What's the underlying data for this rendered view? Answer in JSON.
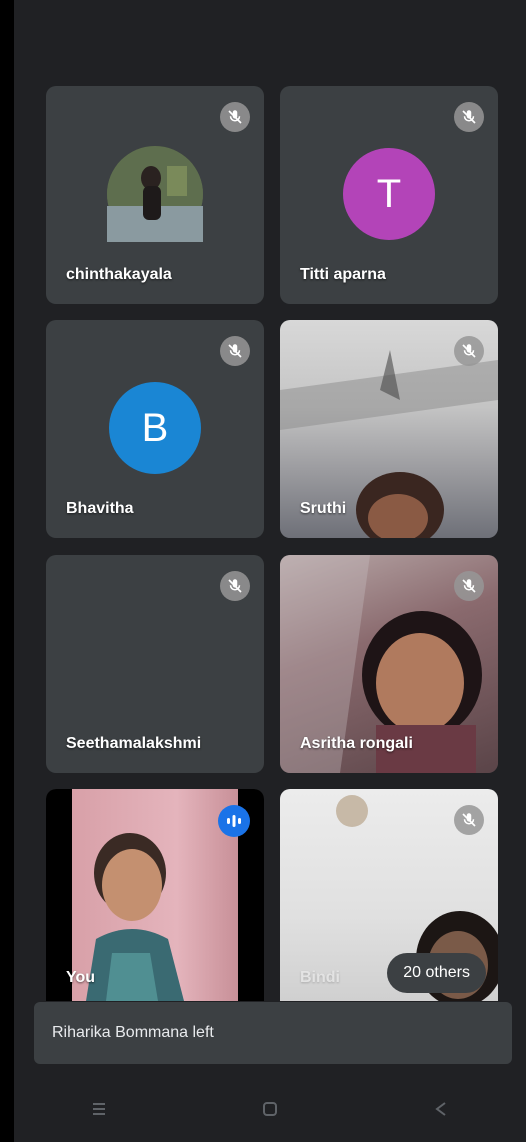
{
  "participants": [
    {
      "name": "chinthakayala",
      "muted": true
    },
    {
      "name": "Titti aparna",
      "muted": true,
      "initial": "T",
      "avatar_color": "#b344b8"
    },
    {
      "name": "Bhavitha",
      "muted": true,
      "initial": "B",
      "avatar_color": "#1a86d4"
    },
    {
      "name": "Sruthi",
      "muted": true
    },
    {
      "name": "Seethamalakshmi",
      "muted": true
    },
    {
      "name": "Asritha rongali",
      "muted": true
    },
    {
      "name": "You",
      "speaking": true
    },
    {
      "name": "Bindi",
      "muted": true
    }
  ],
  "others_label": "20 others",
  "toast": "Riharika Bommana left",
  "colors": {
    "background": "#202124",
    "tile": "#3c4043",
    "speaking": "#1a73e8"
  },
  "icons": {
    "mute": "mic-off-icon",
    "speaking": "audio-level-icon",
    "nav_recents": "recents-icon",
    "nav_home": "home-icon",
    "nav_back": "back-icon"
  }
}
